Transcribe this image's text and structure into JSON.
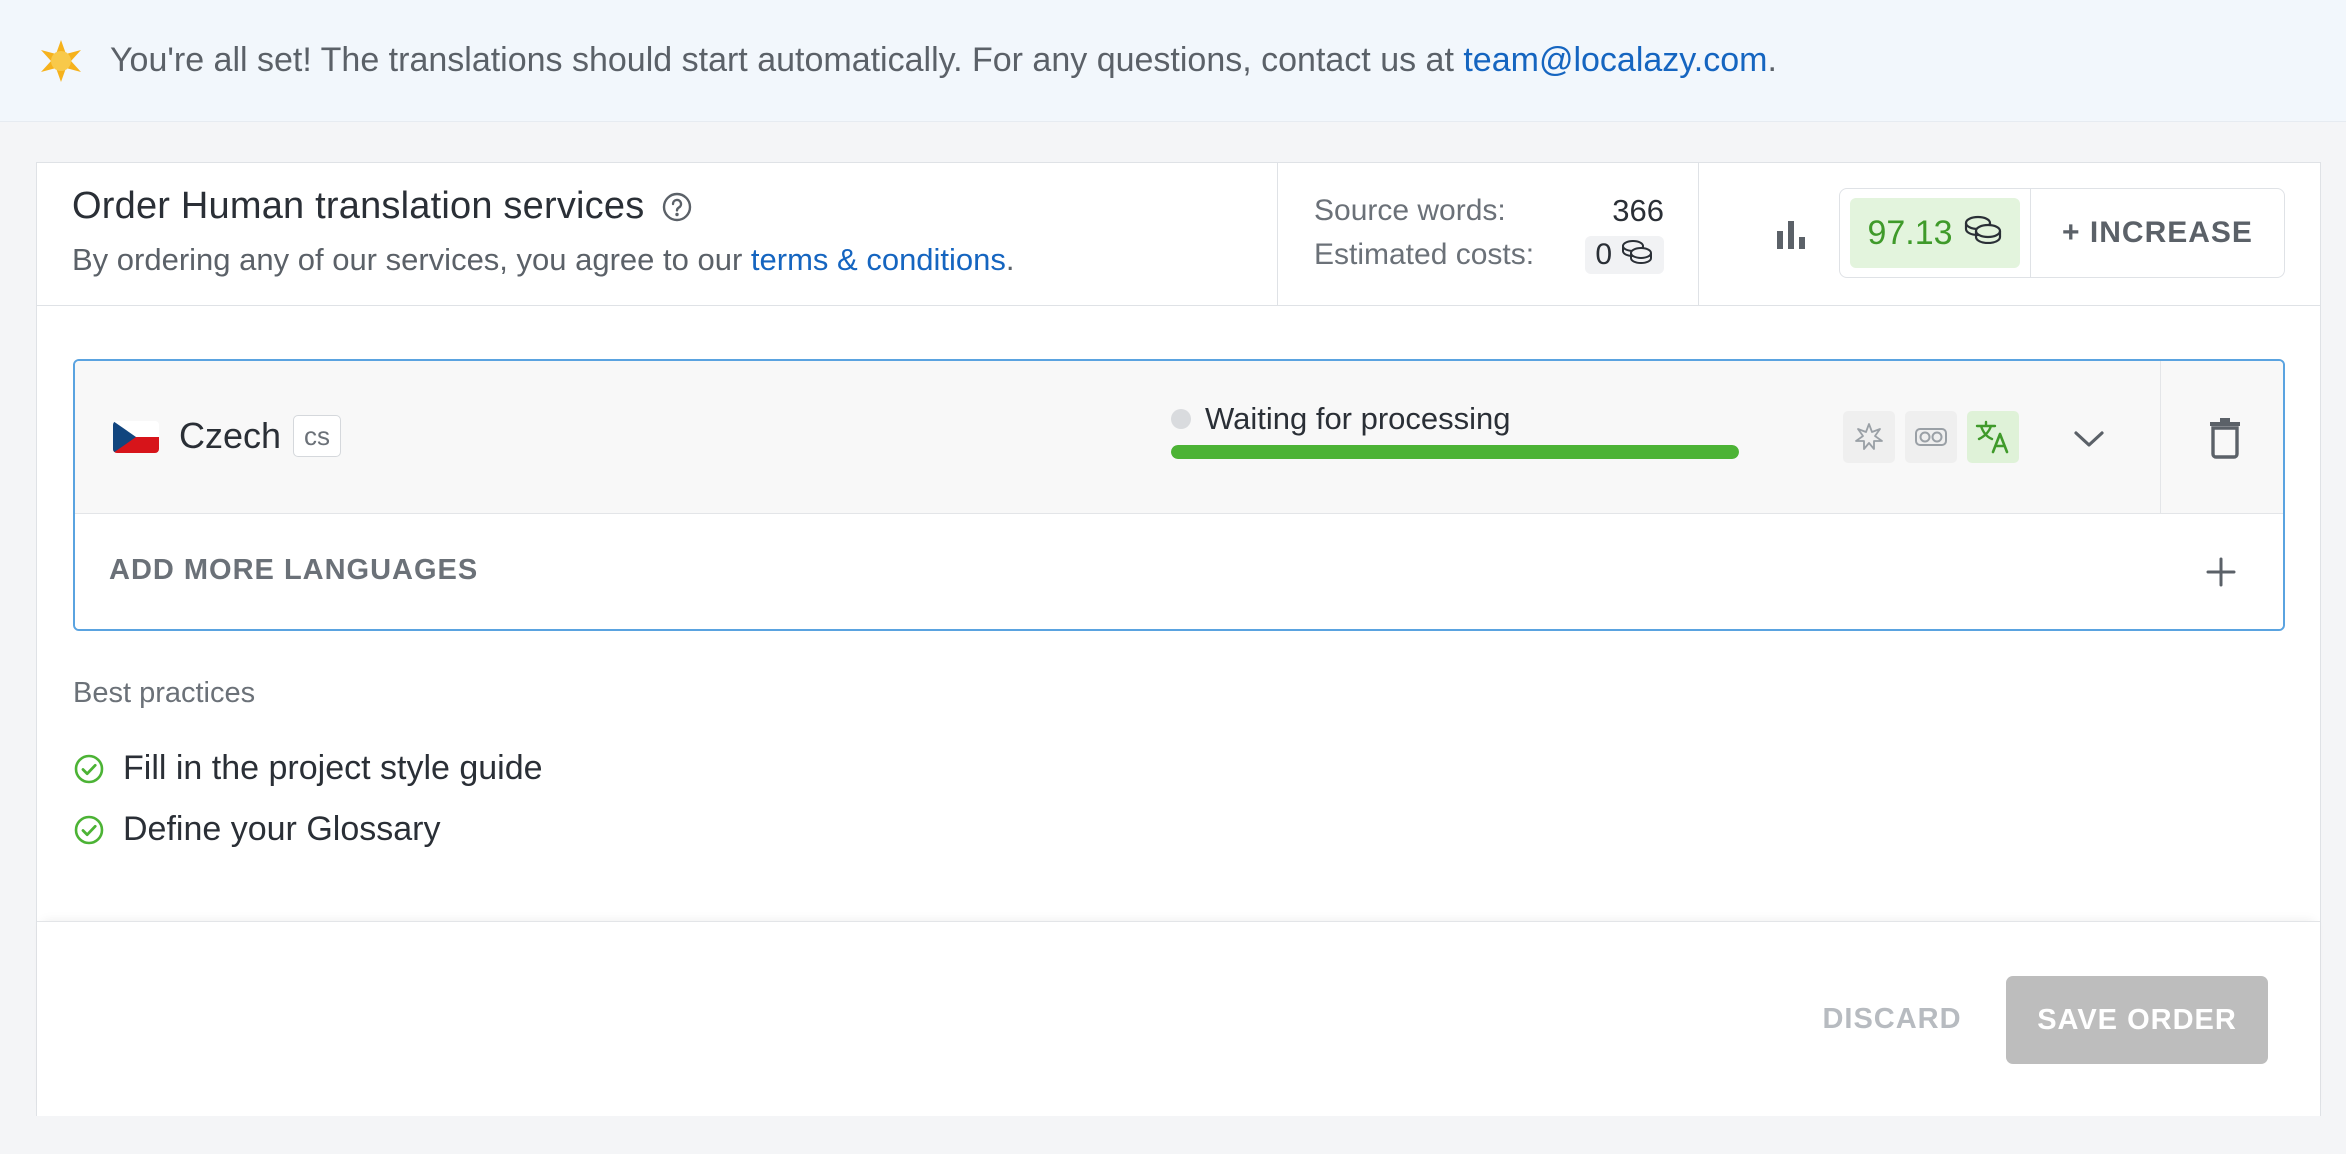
{
  "banner": {
    "icon": "star-icon",
    "message": "You're all set! The translations should start automatically. For any questions, contact us at ",
    "email": "team@localazy.com",
    "suffix": "."
  },
  "header": {
    "title": "Order Human translation services",
    "subtitle_prefix": "By ordering any of our services, you agree to our ",
    "terms_link": "terms & conditions",
    "subtitle_suffix": "."
  },
  "stats": {
    "source_words_label": "Source words:",
    "source_words_value": "366",
    "estimated_costs_label": "Estimated costs:",
    "estimated_costs_value": "0"
  },
  "balance": {
    "value": "97.13",
    "increase_label": "+ INCREASE"
  },
  "language": {
    "name": "Czech",
    "code": "cs",
    "status": "Waiting for processing",
    "progress_fraction": 1.0,
    "services": [
      "sparkle-icon",
      "glasses-icon",
      "translate-icon"
    ],
    "active_service": "translate-icon",
    "add_more_label": "ADD MORE LANGUAGES"
  },
  "best_practices": {
    "title": "Best practices",
    "items": [
      {
        "label": "Fill in the project style guide"
      },
      {
        "label": "Define your Glossary"
      }
    ]
  },
  "footer": {
    "discard_label": "DISCARD",
    "save_label": "SAVE ORDER"
  },
  "colors": {
    "accent_link": "#1565c0",
    "success": "#4cb335",
    "panel_border": "#5aa3e0",
    "disabled_button": "#bdbdbd"
  }
}
